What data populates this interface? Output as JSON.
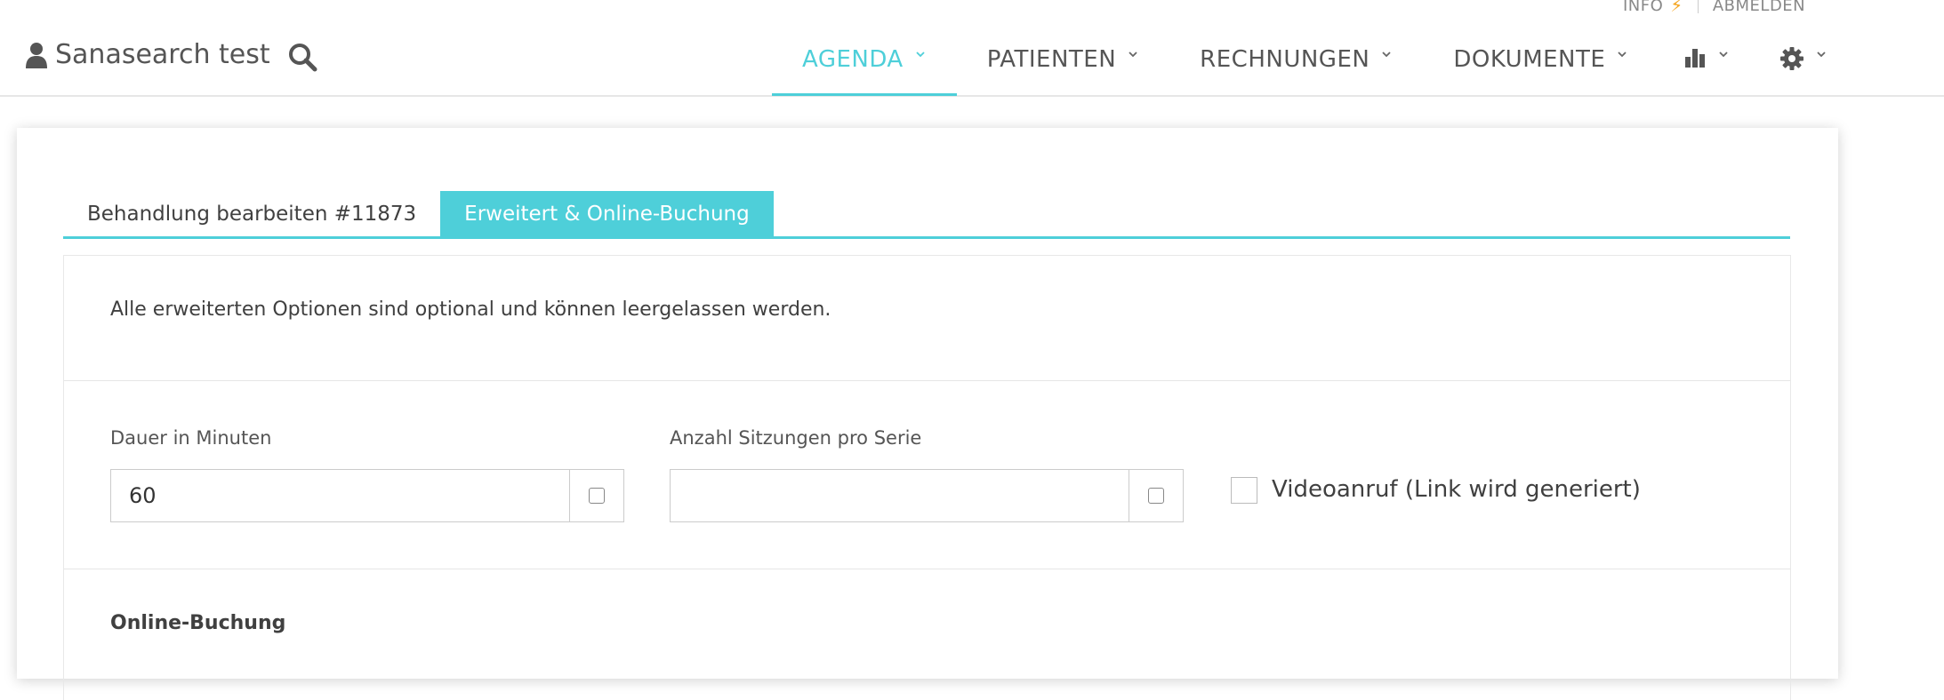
{
  "toplinks": {
    "info": "INFO",
    "logout": "ABMELDEN"
  },
  "header": {
    "brand": "Sanasearch test",
    "nav": [
      {
        "label": "AGENDA",
        "active": true
      },
      {
        "label": "PATIENTEN"
      },
      {
        "label": "RECHNUNGEN"
      },
      {
        "label": "DOKUMENTE"
      }
    ]
  },
  "tabs": {
    "edit": "Behandlung bearbeiten #11873",
    "advanced": "Erweitert & Online-Buchung"
  },
  "panel": {
    "info": "Alle erweiterten Optionen sind optional und können leergelassen werden.",
    "duration_label": "Dauer in Minuten",
    "duration_value": "60",
    "sessions_label": "Anzahl Sitzungen pro Serie",
    "sessions_value": "",
    "video_label": "Videoanruf (Link wird generiert)",
    "online_booking_title": "Online-Buchung"
  },
  "colors": {
    "accent": "#4ecfd9",
    "bolt": "#f5a623"
  }
}
